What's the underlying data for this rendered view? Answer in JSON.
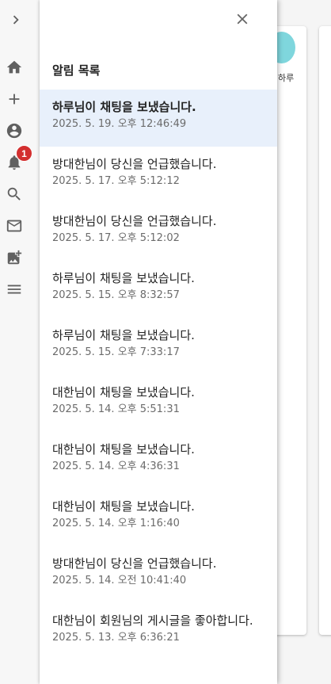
{
  "rail": {
    "notification_count": "1",
    "items": [
      {
        "icon": "chevron-right-icon"
      },
      {
        "icon": "home-icon"
      },
      {
        "icon": "plus-icon"
      },
      {
        "icon": "account-circle-icon"
      },
      {
        "icon": "bell-icon"
      },
      {
        "icon": "search-icon"
      },
      {
        "icon": "mail-icon"
      },
      {
        "icon": "add-photo-icon"
      },
      {
        "icon": "menu-icon"
      }
    ]
  },
  "background": {
    "avatar_label": "하루"
  },
  "drawer": {
    "title": "알림 목록",
    "close_icon": "close-icon",
    "notifications": [
      {
        "message": "하루님이 채팅을 보냈습니다.",
        "time": "2025. 5. 19. 오후 12:46:49",
        "active": true
      },
      {
        "message": "방대한님이 당신을 언급했습니다.",
        "time": "2025. 5. 17. 오후 5:12:12"
      },
      {
        "message": "방대한님이 당신을 언급했습니다.",
        "time": "2025. 5. 17. 오후 5:12:02"
      },
      {
        "message": "하루님이 채팅을 보냈습니다.",
        "time": "2025. 5. 15. 오후 8:32:57"
      },
      {
        "message": "하루님이 채팅을 보냈습니다.",
        "time": "2025. 5. 15. 오후 7:33:17"
      },
      {
        "message": "대한님이 채팅을 보냈습니다.",
        "time": "2025. 5. 14. 오후 5:51:31"
      },
      {
        "message": "대한님이 채팅을 보냈습니다.",
        "time": "2025. 5. 14. 오후 4:36:31"
      },
      {
        "message": "대한님이 채팅을 보냈습니다.",
        "time": "2025. 5. 14. 오후 1:16:40"
      },
      {
        "message": "방대한님이 당신을 언급했습니다.",
        "time": "2025. 5. 14. 오전 10:41:40"
      },
      {
        "message": "대한님이 회원님의 게시글을 좋아합니다.",
        "time": "2025. 5. 13. 오후 6:36:21"
      }
    ]
  }
}
